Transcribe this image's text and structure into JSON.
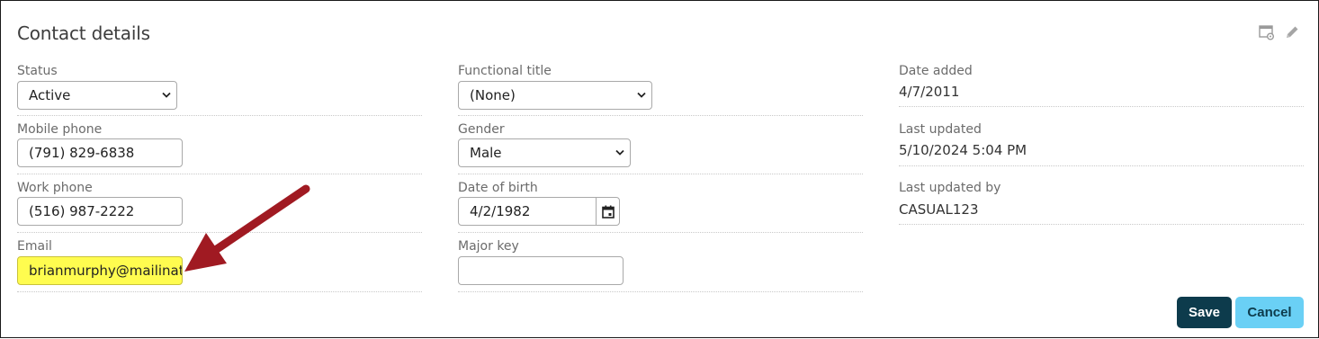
{
  "panel": {
    "title": "Contact details"
  },
  "header_icons": [
    "settings-window-icon",
    "pencil-edit-icon"
  ],
  "column1": {
    "status": {
      "label": "Status",
      "value": "Active"
    },
    "mobile_phone": {
      "label": "Mobile phone",
      "value": "(791) 829-6838"
    },
    "work_phone": {
      "label": "Work phone",
      "value": "(516) 987-2222"
    },
    "email": {
      "label": "Email",
      "value": "brianmurphy@mailinat"
    }
  },
  "column2": {
    "functional_title": {
      "label": "Functional title",
      "value": "(None)"
    },
    "gender": {
      "label": "Gender",
      "value": "Male"
    },
    "date_of_birth": {
      "label": "Date of birth",
      "value": "4/2/1982"
    },
    "major_key": {
      "label": "Major key",
      "value": ""
    }
  },
  "column3": {
    "date_added": {
      "label": "Date added",
      "value": "4/7/2011"
    },
    "last_updated": {
      "label": "Last updated",
      "value": "5/10/2024 5:04 PM"
    },
    "last_updated_by": {
      "label": "Last updated by",
      "value": "CASUAL123"
    }
  },
  "buttons": {
    "save": "Save",
    "cancel": "Cancel"
  },
  "colors": {
    "save_bg": "#0d3b4c",
    "cancel_bg": "#6ad0f5",
    "email_highlight": "#fffc4f",
    "annotation_arrow": "#a01a22"
  }
}
